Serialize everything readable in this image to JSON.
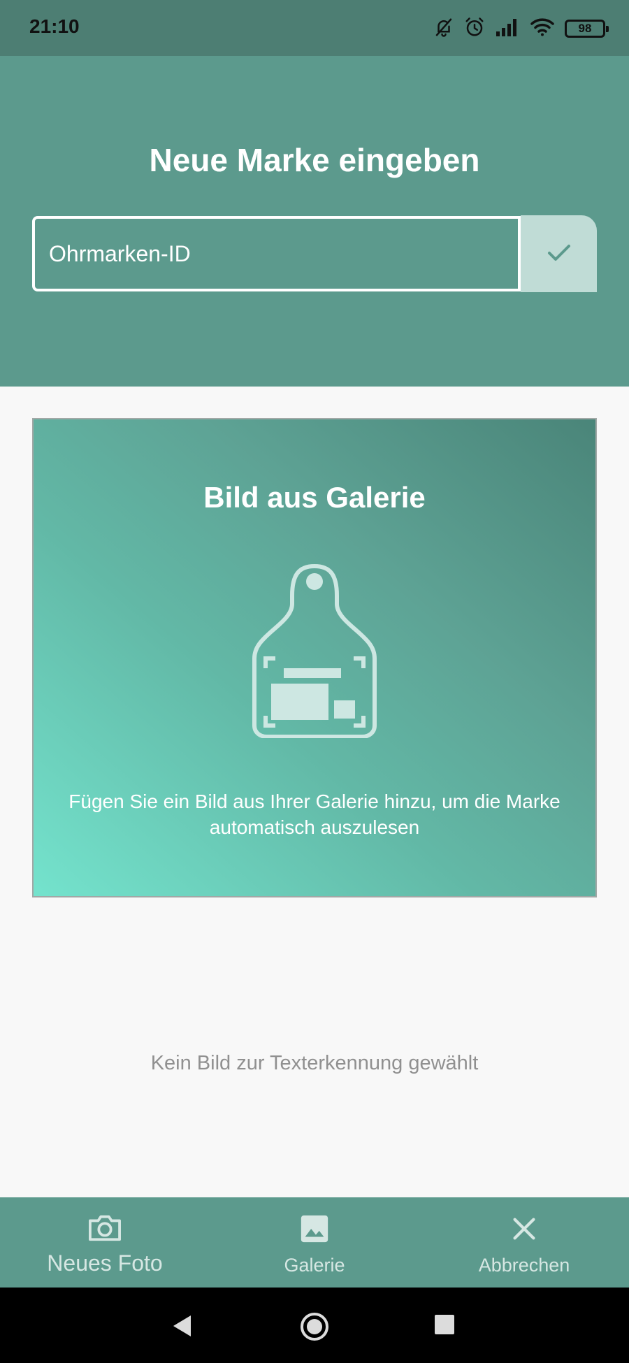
{
  "status_bar": {
    "time": "21:10",
    "battery": "98",
    "icons": [
      "bell-off-icon",
      "alarm-icon",
      "signal-icon",
      "wifi-icon",
      "battery-icon"
    ]
  },
  "header": {
    "title": "Neue Marke eingeben",
    "input_placeholder": "Ohrmarken-ID",
    "input_value": "",
    "confirm_icon": "check-icon"
  },
  "gallery_card": {
    "title": "Bild aus Galerie",
    "icon": "ear-tag-scan-icon",
    "description": "Fügen Sie ein Bild aus Ihrer Galerie hinzu, um die Marke automatisch auszulesen"
  },
  "status_message": "Kein Bild zur Texterkennung gewählt",
  "bottom_nav": {
    "items": [
      {
        "label": "Neues Foto",
        "icon": "camera-icon"
      },
      {
        "label": "Galerie",
        "icon": "image-icon"
      },
      {
        "label": "Abbrechen",
        "icon": "close-icon"
      }
    ]
  },
  "system_nav": {
    "icons": [
      "back-icon",
      "home-icon",
      "recents-icon"
    ]
  },
  "colors": {
    "primary": "#5c9a8d",
    "status_bar": "#4d7e73",
    "confirm_bg": "#c0dcd6",
    "nav_label": "#d6e7e3",
    "gradient_light": "#74e3cd",
    "gradient_dark": "#4a8579",
    "muted_text": "#909090"
  }
}
